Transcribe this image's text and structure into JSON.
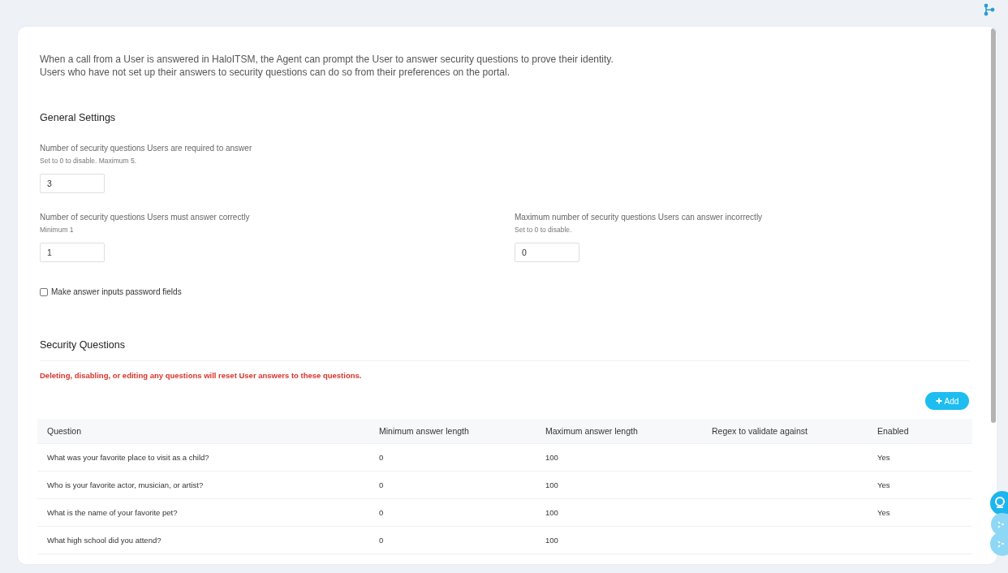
{
  "intro": {
    "lines": [
      "When a call from a User is answered in HaloITSM, the Agent can prompt the User to answer security questions to prove their identity.",
      "Users who have not set up their answers to security questions can do so from their preferences on the portal."
    ]
  },
  "general_settings": {
    "title": "General Settings",
    "field_rows": [
      [
        {
          "label": "Number of security questions Users are required to answer",
          "hint": "Set to 0 to disable. Maximum 5.",
          "value": "3"
        }
      ],
      [
        {
          "label": "Number of security questions Users must answer correctly",
          "hint": "Minimum 1",
          "value": "1"
        },
        {
          "label": "Maximum number of security questions Users can answer incorrectly",
          "hint": "Set to 0 to disable.",
          "value": "0"
        }
      ]
    ],
    "checkbox": {
      "label": "Make answer inputs password fields",
      "checked": false
    }
  },
  "security_questions": {
    "title": "Security Questions",
    "warning": "Deleting, disabling, or editing any questions will reset User answers to these questions.",
    "add_button": {
      "label": "Add"
    },
    "table": {
      "columns": [
        "Question",
        "Minimum answer length",
        "Maximum answer length",
        "Regex to validate against",
        "Enabled"
      ],
      "rows": [
        {
          "question": "What was your favorite place to visit as a child?",
          "minimum_answer_length": "0",
          "maximum_answer_length": "100",
          "enabled": "Yes"
        },
        {
          "question": "Who is your favorite actor, musician, or artist?",
          "minimum_answer_length": "0",
          "maximum_answer_length": "100",
          "enabled": "Yes"
        },
        {
          "question": "What is the name of your favorite pet?",
          "minimum_answer_length": "0",
          "maximum_answer_length": "100",
          "enabled": "Yes"
        },
        {
          "question": "What high school did you attend?",
          "minimum_answer_length": "0",
          "maximum_answer_length": "100"
        }
      ]
    }
  }
}
